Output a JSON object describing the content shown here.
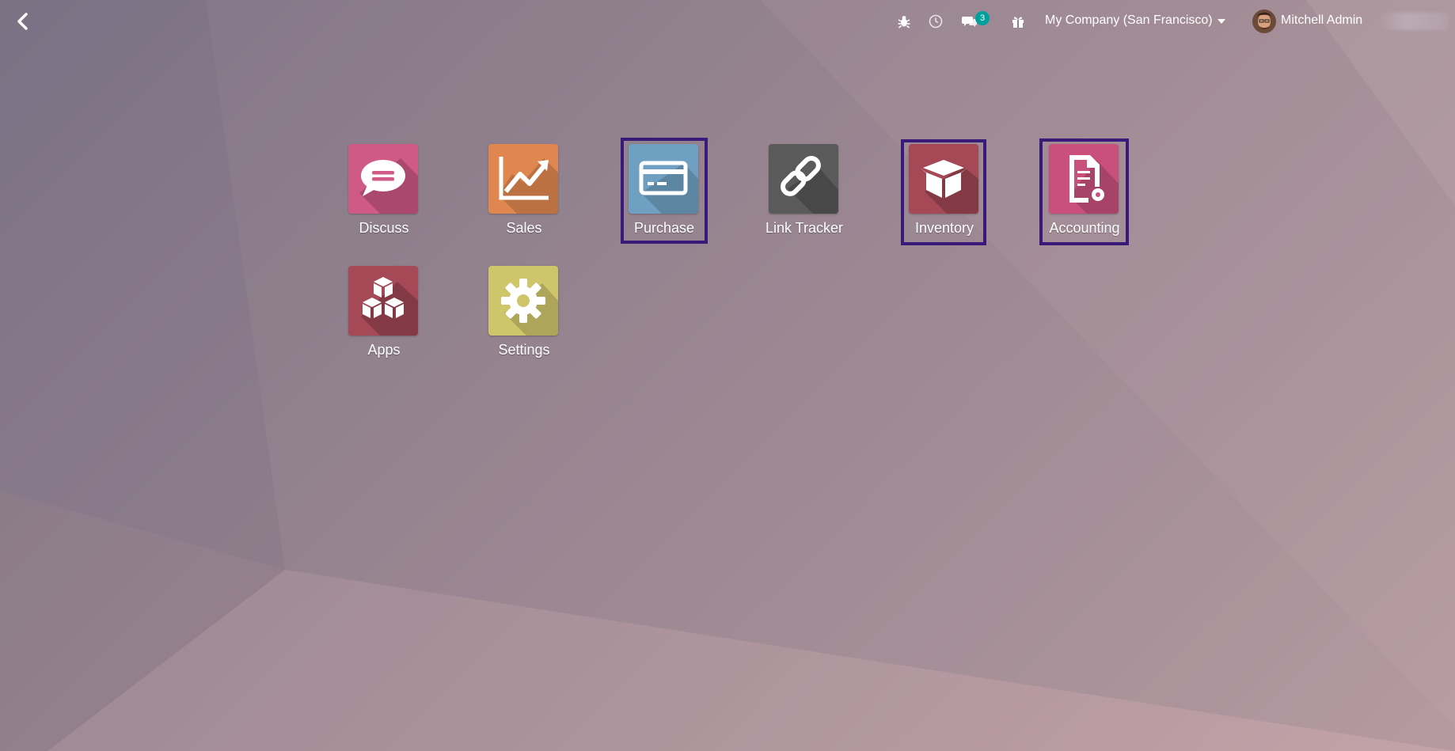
{
  "navbar": {
    "back_icon": "chevron-left-icon",
    "systray": {
      "debug_icon": "bug-icon",
      "activity_icon": "clock-icon",
      "messages_icon": "chat-icon",
      "messages_count": "3",
      "gift_icon": "gift-icon"
    },
    "company": "My Company (San Francisco)",
    "user": "Mitchell Admin"
  },
  "apps": [
    {
      "label": "Discuss",
      "icon": "chat-bubble-icon",
      "color": "#d05a86",
      "highlighted": false
    },
    {
      "label": "Sales",
      "icon": "chart-line-icon",
      "color": "#e0874f",
      "highlighted": false
    },
    {
      "label": "Purchase",
      "icon": "credit-card-icon",
      "color": "#6fa0c2",
      "highlighted": true
    },
    {
      "label": "Link Tracker",
      "icon": "link-icon",
      "color": "#5a5a5a",
      "highlighted": false
    },
    {
      "label": "Inventory",
      "icon": "box-open-icon",
      "color": "#a44955",
      "highlighted": true
    },
    {
      "label": "Accounting",
      "icon": "document-gear-icon",
      "color": "#c8507a",
      "highlighted": true
    },
    {
      "label": "Apps",
      "icon": "cubes-icon",
      "color": "#a44955",
      "highlighted": false
    },
    {
      "label": "Settings",
      "icon": "gear-icon",
      "color": "#cfc56a",
      "highlighted": false
    }
  ],
  "colors": {
    "highlight_border": "#3a1a78",
    "badge": "#00a09d"
  }
}
